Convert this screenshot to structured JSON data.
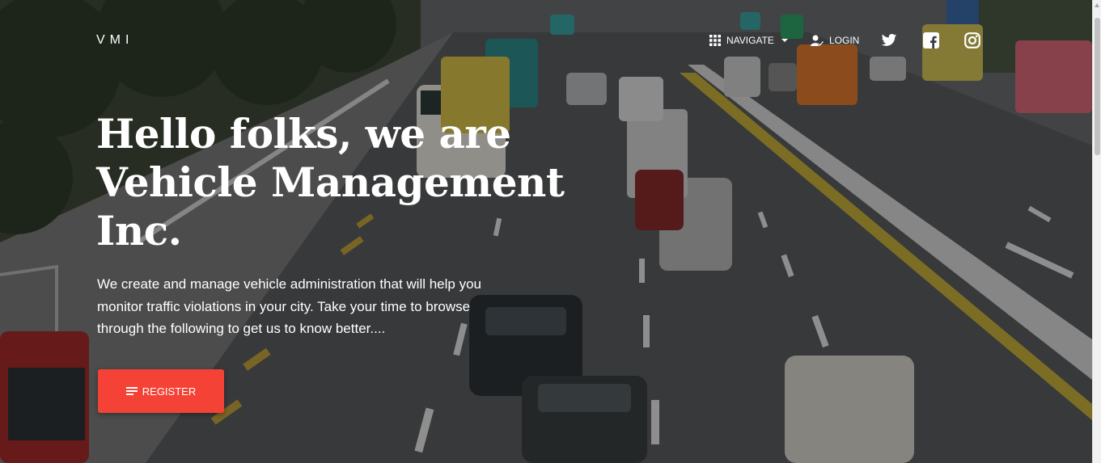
{
  "navbar": {
    "brand": "VMI",
    "navigate_label": "Navigate",
    "login_label": "Login",
    "social": [
      "twitter-icon",
      "facebook-icon",
      "instagram-icon"
    ]
  },
  "hero": {
    "headline_line1": "Hello folks, we are",
    "headline_line2": "Vehicle Management",
    "headline_line3": "Inc.",
    "subtitle": "We create and manage vehicle administration that will help you monitor traffic violations in your city. Take your time to browse through the following to get us to know better....",
    "register_label": "Register"
  },
  "colors": {
    "accent": "#f44336",
    "text": "#ffffff"
  }
}
